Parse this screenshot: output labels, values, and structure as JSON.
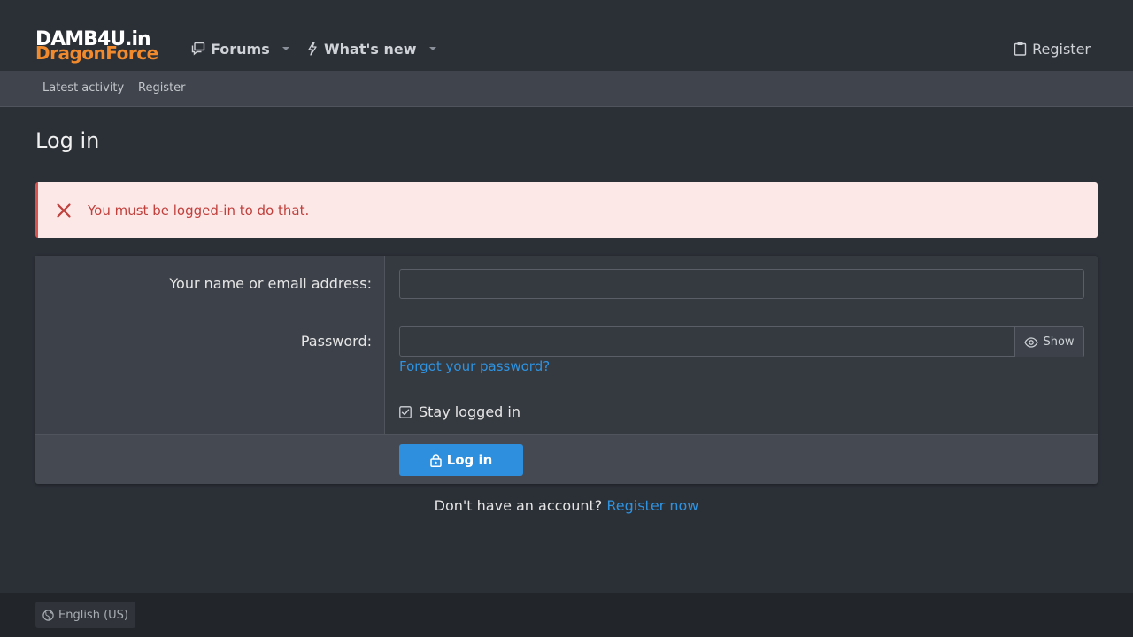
{
  "header": {
    "logo_line1": "DAMB4U.in",
    "logo_line2": "DragonForce",
    "nav": {
      "forums": "Forums",
      "whats_new": "What's new"
    },
    "register": "Register"
  },
  "subnav": {
    "latest_activity": "Latest activity",
    "register": "Register"
  },
  "page": {
    "title": "Log in"
  },
  "error": {
    "message": "You must be logged-in to do that."
  },
  "form": {
    "name_label": "Your name or email address:",
    "name_value": "",
    "password_label": "Password:",
    "password_value": "",
    "show_label": "Show",
    "forgot_link": "Forgot your password?",
    "stay_logged_in": "Stay logged in",
    "stay_checked": true,
    "login_button": "Log in"
  },
  "signup": {
    "prompt": "Don't have an account?",
    "link": "Register now"
  },
  "footer": {
    "language": "English (US)"
  },
  "colors": {
    "accent": "#2f8fdf",
    "link": "#2f93e0",
    "logo_orange": "#f08a2c",
    "error_bg": "#fde8e8",
    "error_text": "#c0403c"
  }
}
